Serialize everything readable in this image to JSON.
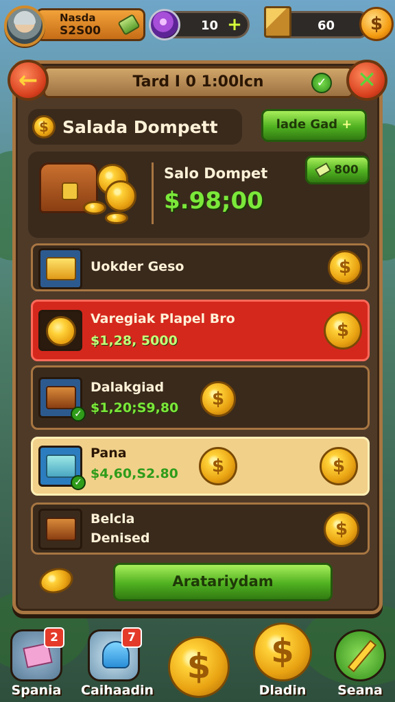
{
  "hud": {
    "player_name": "Nasda",
    "player_money": "S2S00",
    "gems": "10",
    "gems_plus": "+",
    "boxes": "60",
    "dollar_glyph": "$"
  },
  "header": {
    "title": "Tard I 0 1:00lcn",
    "back_glyph": "←",
    "close_glyph": "✕",
    "check_glyph": "✓"
  },
  "wallet": {
    "section_title": "Salada Dompett",
    "add_card_label": "lade Gad",
    "add_card_plus": "+",
    "label": "Salo Dompet",
    "amount": "$.98;00",
    "cash_button_label": "800"
  },
  "cards": [
    {
      "title": "Uokder Geso",
      "sub": "",
      "icon": "money-stack-icon",
      "coin": "$"
    },
    {
      "title": "Varegiak Plapel Bro",
      "sub": "$1,28, 5000",
      "icon": "gold-coin-icon",
      "coin": "$"
    },
    {
      "title": "Dalakgiad",
      "sub": "$1,20;S9,80",
      "icon": "treasure-chest-icon",
      "coin": "$"
    },
    {
      "title": "Pana",
      "sub": "$4,60,S2.80",
      "icon": "bills-icon",
      "coin": "$",
      "coin2": "$"
    },
    {
      "title": "Belcla",
      "sub": "Denised",
      "icon": "treasure-chest-icon",
      "coin": "$"
    }
  ],
  "actions": {
    "primary_label": "Aratariydam"
  },
  "bottom_nav": [
    {
      "label": "Spania",
      "badge": "2",
      "icon": "cards-icon"
    },
    {
      "label": "Caihaadin",
      "badge": "7",
      "icon": "helmet-icon"
    },
    {
      "label": "",
      "icon": "coin-icon",
      "glyph": "$"
    },
    {
      "label": "Dladin",
      "icon": "coin-icon",
      "glyph": "$"
    },
    {
      "label": "Seana",
      "icon": "pencil-icon"
    }
  ],
  "colors": {
    "accent_green": "#4fb020",
    "highlight_red": "#d5281d",
    "panel_brown": "#4f3a28",
    "gold": "#ffd23a"
  }
}
